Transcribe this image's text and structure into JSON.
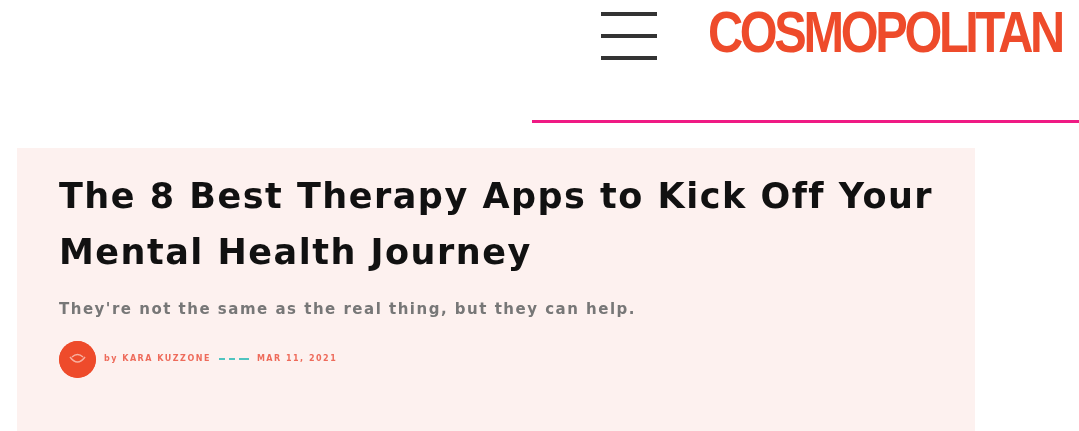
{
  "header": {
    "logo": "COSMOPOLITAN"
  },
  "article": {
    "title": "The 8 Best Therapy Apps to Kick Off Your Mental Health Journey",
    "dek": "They're not the same as the real thing, but they can help.",
    "byline": {
      "author": "by KARA KUZZONE",
      "date": "MAR 11, 2021"
    }
  }
}
